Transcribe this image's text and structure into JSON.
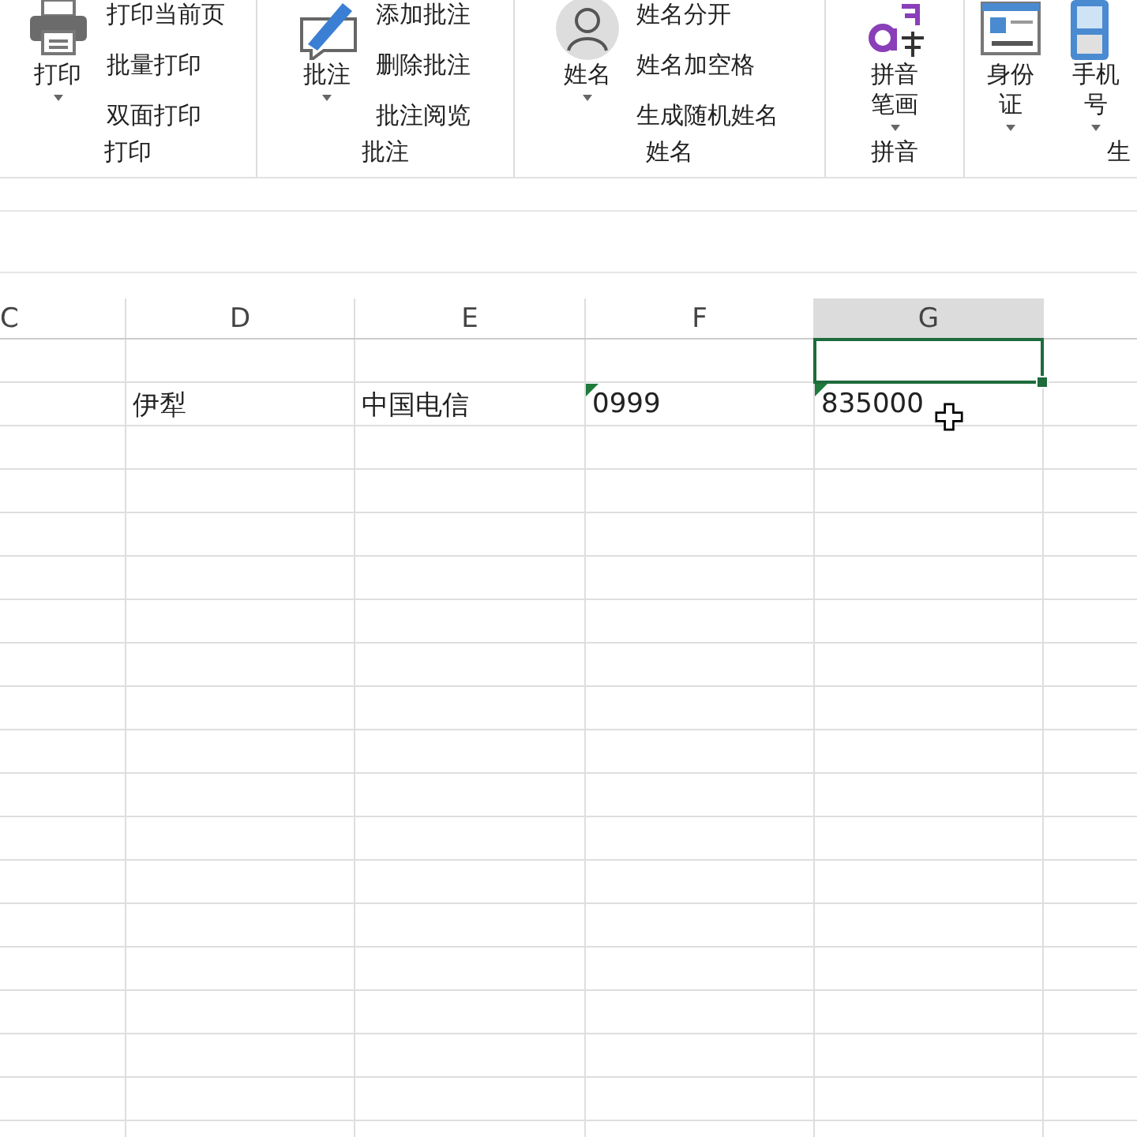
{
  "ribbon": {
    "groups": [
      {
        "label": "打印",
        "large": [
          {
            "label": "打印",
            "dropdown": true
          }
        ],
        "small": [
          "打印当前页",
          "批量打印",
          "双面打印"
        ]
      },
      {
        "label": "批注",
        "large": [
          {
            "label": "批注",
            "dropdown": true
          }
        ],
        "small": [
          "添加批注",
          "删除批注",
          "批注阅览"
        ]
      },
      {
        "label": "姓名",
        "large": [
          {
            "label": "姓名",
            "dropdown": true
          }
        ],
        "small": [
          "姓名分开",
          "姓名加空格",
          "生成随机姓名"
        ]
      },
      {
        "label": "拼音",
        "large": [
          {
            "label": "拼音笔画",
            "dropdown": true
          }
        ]
      },
      {
        "label": "生",
        "large": [
          {
            "label": "身份证",
            "dropdown": true
          },
          {
            "label": "手机号",
            "dropdown": true
          }
        ]
      }
    ]
  },
  "sheet": {
    "columns": [
      {
        "label": "C",
        "selected": false
      },
      {
        "label": "D",
        "selected": false
      },
      {
        "label": "E",
        "selected": false
      },
      {
        "label": "F",
        "selected": false
      },
      {
        "label": "G",
        "selected": true
      }
    ],
    "rows": [
      {
        "cells": [
          {
            "flag": false,
            "active": false
          },
          {
            "flag": false,
            "active": false
          },
          {
            "flag": false,
            "active": false
          },
          {
            "flag": false,
            "active": false
          },
          {
            "flag": false,
            "active": true
          }
        ]
      },
      {
        "cells": [
          {
            "flag": false,
            "active": false
          },
          {
            "text": "伊犁",
            "flag": false,
            "active": false
          },
          {
            "text": "中国电信",
            "flag": false,
            "active": false
          },
          {
            "text": "0999",
            "flag": true,
            "active": false
          },
          {
            "text": "835000",
            "flag": true,
            "active": false
          }
        ]
      }
    ]
  }
}
